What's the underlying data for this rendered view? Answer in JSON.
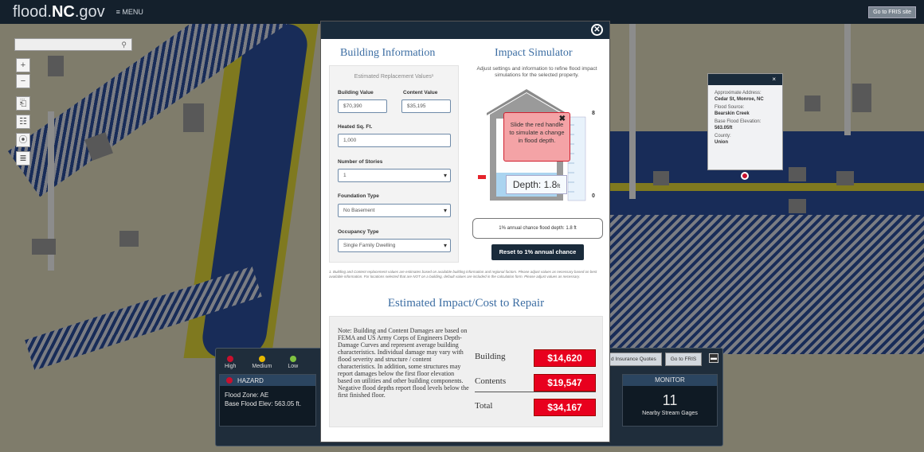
{
  "topbar": {
    "brand_prefix": "flood.",
    "brand_bold": "NC",
    "brand_suffix": ".gov",
    "menu_label": "≡ MENU",
    "fris_button": "Go to FRIS site"
  },
  "map": {
    "search_icon": "⚲",
    "tools": [
      "+",
      "−",
      "⎗",
      "☷",
      "⦿",
      "≣"
    ],
    "popup": {
      "close": "×",
      "address_label": "Approximate Address:",
      "address_value": "Cedar St, Monroe, NC",
      "flood_source_label": "Flood Source:",
      "flood_source_value": "Bearskin Creek",
      "bfe_label": "Base Flood Elevation:",
      "bfe_value": "563.05ft",
      "county_label": "County:",
      "county_value": "Union"
    }
  },
  "dashboard": {
    "legend": [
      {
        "label": "High",
        "color": "#c8102e"
      },
      {
        "label": "Medium",
        "color": "#e6b800"
      },
      {
        "label": "Low",
        "color": "#7fc241"
      }
    ],
    "hazard": {
      "title": "HAZARD",
      "flood_zone_label": "Flood Zone:",
      "flood_zone_value": "AE",
      "bfe_label": "Base Flood Elev:",
      "bfe_value": "563.05 ft."
    },
    "buttons": [
      "d Insurance Quotes",
      "Go to FRIS"
    ],
    "monitor": {
      "title": "MONITOR",
      "count": "11",
      "subtitle": "Nearby Stream Gages"
    }
  },
  "modal": {
    "close": "✕",
    "building_info_title": "Building Information",
    "impact_sim_title": "Impact Simulator",
    "estimated_values_label": "Estimated Replacement Values¹",
    "building_value_label": "Building Value",
    "building_value": "$70,390",
    "content_value_label": "Content Value",
    "content_value": "$35,195",
    "heated_sqft_label": "Heated Sq. Ft.",
    "heated_sqft_value": "1,000",
    "stories_label": "Number of Stories",
    "stories_value": "1",
    "foundation_label": "Foundation Type",
    "foundation_value": "No Basement",
    "occupancy_label": "Occupancy Type",
    "occupancy_value": "Single Family Dwelling",
    "sim_description": "Adjust settings and information to refine flood impact simulations for the selected property.",
    "tooltip_text": "Slide the red handle to simulate a change in flood depth.",
    "tooltip_close": "✖",
    "depth_label": "Depth:",
    "depth_value": "1.8",
    "depth_unit": "ft",
    "scale_max": "8",
    "scale_min": "0",
    "annual_text": "1% annual chance flood depth: 1.8 ft",
    "reset_button": "Reset to 1% annual chance",
    "footnote": "1. Building and Content replacement values are estimates based on available building information and regional factors. Please adjust values as necessary based on best available information. For locations selected that are NOT on a building, default values are included in the calculation form. Please adjust values as necessary.",
    "estimated_title": "Estimated Impact/Cost to Repair",
    "note": "Note: Building and Content Damages are based on FEMA and US Army Corps of Engineers Depth-Damage Curves and represent average building characteristics. Individual damage may vary with flood severity and structure / content characteristics. In addition, some structures may report damages below the first floor elevation based on utilities and other building components. Negative flood depths report flood levels below the first finished floor.",
    "costs": {
      "building_label": "Building",
      "building_value": "$14,620",
      "contents_label": "Contents",
      "contents_value": "$19,547",
      "total_label": "Total",
      "total_value": "$34,167"
    }
  }
}
